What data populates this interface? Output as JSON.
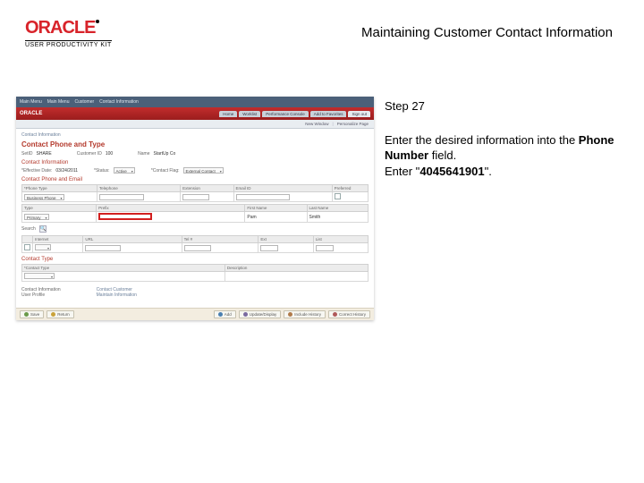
{
  "logo": {
    "brand": "ORACLE",
    "sub": "USER PRODUCTIVITY KIT"
  },
  "doc_title": "Maintaining Customer Contact Information",
  "panel": {
    "step": "Step 27",
    "line1_a": "Enter the desired information into the ",
    "line1_bold": "Phone Number",
    "line1_b": " field.",
    "line2_a": "Enter \"",
    "line2_bold": "4045641901",
    "line2_b": "\"."
  },
  "shot": {
    "nav": {
      "a": "Main Menu",
      "b": "Main Menu",
      "c": "Customer",
      "d": "Contact Information"
    },
    "brand": "ORACLE",
    "tabs": [
      "Home",
      "Worklist",
      "Performance Console",
      "Add to Favorites",
      "Sign out"
    ],
    "subbar": {
      "a": "New Window",
      "b": "Personalize Page"
    },
    "crumb": "Contact Information",
    "h1": "Contact Phone and Type",
    "meta": {
      "setid_lbl": "SetID",
      "setid": "SHARE",
      "cust_lbl": "Customer ID",
      "cust": "100",
      "name_lbl": "Name",
      "name": "StartUp Co"
    },
    "sec_contact": "Contact Information",
    "effrow": {
      "eff_lbl": "*Effective Date:",
      "eff": "03/24/2011",
      "stat_lbl": "*Status:",
      "stat": "Active",
      "type_lbl": "*Contact Flag:",
      "type": "External Contact"
    },
    "sec_phone": "Contact Phone and Email",
    "phone_head": [
      "*Phone Type",
      "Telephone",
      "Extension",
      "Email ID",
      "Preferred"
    ],
    "phone_row": {
      "type": "Business Phone"
    },
    "name_head": [
      "Type",
      "Prefix",
      "First Name",
      "Last Name"
    ],
    "name_row": {
      "type": "Primary",
      "first": "Pam",
      "last": "Smith"
    },
    "search_lbl": "Search",
    "int_head": [
      "",
      "Internet",
      "URL",
      "Tel #",
      "Ext",
      "List"
    ],
    "sec_ctype": "Contact Type",
    "ctype_head": [
      "*Contact Type",
      "Description"
    ],
    "two_col": {
      "a_lbl": "Contact Information",
      "a_val": "Contact Customer",
      "b_lbl": "User Profile",
      "b_val": "Maintain Information"
    },
    "buttons": {
      "save": "Save",
      "ret": "Return",
      "add": "Add",
      "upd": "Update/Display",
      "hist": "Include History",
      "corr": "Correct History"
    }
  }
}
